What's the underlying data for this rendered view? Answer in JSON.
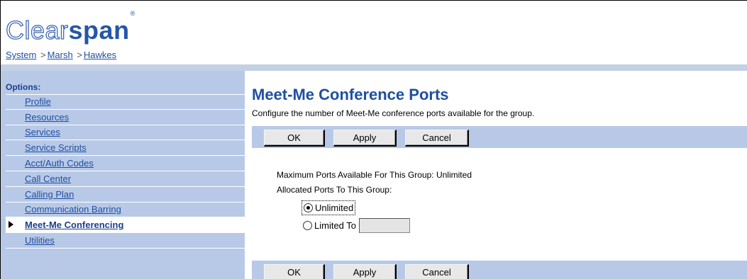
{
  "logo": {
    "part1": "Clear",
    "part2": "span",
    "mark": "®"
  },
  "breadcrumb": {
    "items": [
      "System",
      "Marsh",
      "Hawkes"
    ],
    "separator": ">"
  },
  "sidebar": {
    "title": "Options:",
    "items": [
      {
        "label": "Profile"
      },
      {
        "label": "Resources"
      },
      {
        "label": "Services"
      },
      {
        "label": "Service Scripts"
      },
      {
        "label": "Acct/Auth Codes"
      },
      {
        "label": "Call Center"
      },
      {
        "label": "Calling Plan"
      },
      {
        "label": "Communication Barring"
      },
      {
        "label": "Meet-Me Conferencing",
        "active": true
      },
      {
        "label": "Utilities"
      }
    ]
  },
  "main": {
    "title": "Meet-Me Conference Ports",
    "description": "Configure the number of Meet-Me conference ports available for the group.",
    "buttons": {
      "ok": "OK",
      "apply": "Apply",
      "cancel": "Cancel"
    },
    "max_ports_line": "Maximum Ports Available For This Group: Unlimited",
    "allocated_label": "Allocated Ports To This Group:",
    "options": {
      "unlimited_label": "Unlimited",
      "limited_label": "Limited To",
      "selected": "unlimited",
      "limited_value": ""
    }
  },
  "colors": {
    "accent": "#1f4fa0",
    "sidebar_bg": "#b8c9e8",
    "button_bg": "#e8e8e8"
  }
}
